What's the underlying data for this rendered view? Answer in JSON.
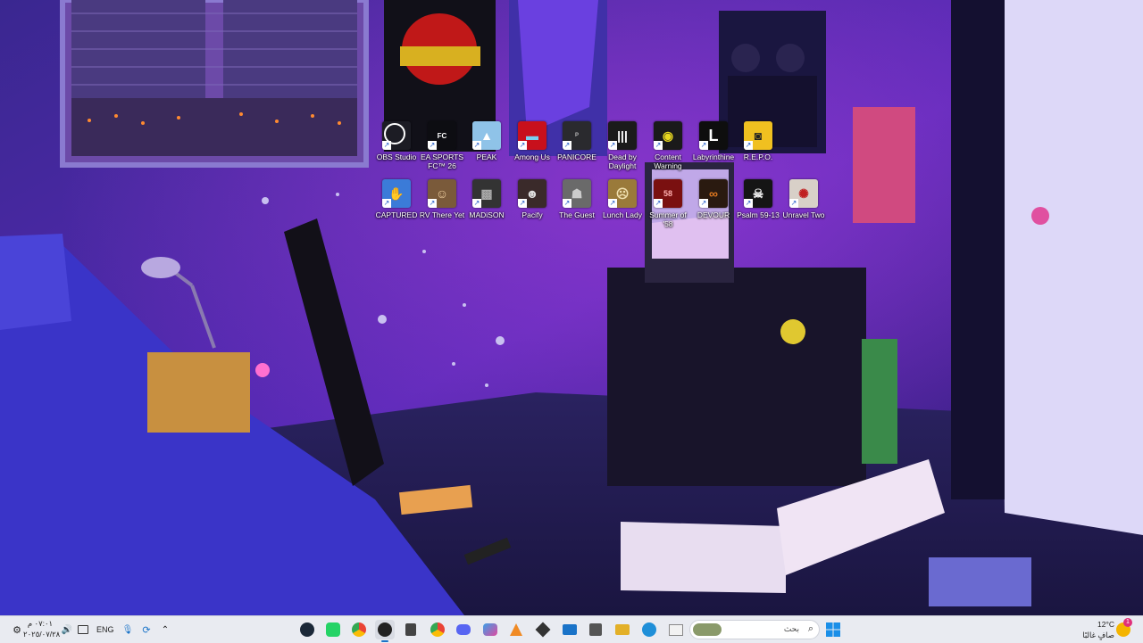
{
  "desktop": {
    "icons_row1": [
      {
        "label": "OBS Studio",
        "icon": "obs-icon",
        "color": "#1c1c24"
      },
      {
        "label": "EA SPORTS FC™ 26",
        "icon": "fc26-icon",
        "color": "#0d0d12"
      },
      {
        "label": "PEAK",
        "icon": "peak-icon",
        "color": "#8fc3e8"
      },
      {
        "label": "Among Us",
        "icon": "among-us-icon",
        "color": "#c8101c"
      },
      {
        "label": "PANICORE",
        "icon": "panicore-icon",
        "color": "#2a2a2e"
      },
      {
        "label": "Dead by Daylight",
        "icon": "dead-by-daylight-icon",
        "color": "#1b1b1b"
      },
      {
        "label": "Content Warning",
        "icon": "content-warning-icon",
        "color": "#1a1a1a"
      },
      {
        "label": "Labyrinthine",
        "icon": "labyrinthine-icon",
        "color": "#0e0e0e"
      },
      {
        "label": "R.E.P.O.",
        "icon": "repo-icon",
        "color": "#f0c020"
      }
    ],
    "icons_row2": [
      {
        "label": "CAPTURED",
        "icon": "captured-icon",
        "color": "#3b7bd8"
      },
      {
        "label": "RV There Yet",
        "icon": "rv-there-yet-icon",
        "color": "#7a5a3a"
      },
      {
        "label": "MADiSON",
        "icon": "madison-icon",
        "color": "#333333"
      },
      {
        "label": "Pacify",
        "icon": "pacify-icon",
        "color": "#3a2a2a"
      },
      {
        "label": "The Guest",
        "icon": "the-guest-icon",
        "color": "#6a6a6a"
      },
      {
        "label": "Lunch Lady",
        "icon": "lunch-lady-icon",
        "color": "#9a7a3a"
      },
      {
        "label": "Summer of '58",
        "icon": "summer-of-58-icon",
        "color": "#7a1010"
      },
      {
        "label": "DEVOUR",
        "icon": "devour-icon",
        "color": "#2a1a10"
      },
      {
        "label": "Psalm 59-13",
        "icon": "psalm-icon",
        "color": "#151515"
      },
      {
        "label": "Unravel Two",
        "icon": "unravel-two-icon",
        "color": "#d8d0c8"
      }
    ]
  },
  "taskbar": {
    "start_icon": "windows-start-icon",
    "search_placeholder": "بحث",
    "apps": [
      {
        "name": "explorer-icon",
        "color": "#f2c230",
        "glyph": "▬"
      },
      {
        "name": "edge-icon",
        "color": "#1f8fd8",
        "glyph": "e"
      },
      {
        "name": "files-app-icon",
        "color": "#e3b028",
        "glyph": "▭"
      },
      {
        "name": "store-icon",
        "color": "#333333",
        "glyph": "⊞"
      },
      {
        "name": "mail-icon",
        "color": "#1a73c8",
        "glyph": "✉"
      },
      {
        "name": "app-dark-icon",
        "color": "#333333",
        "glyph": "◆"
      },
      {
        "name": "vlc-like-icon",
        "color": "#f08a24",
        "glyph": "▲"
      },
      {
        "name": "copilot-icon",
        "color": "#3aa0e8",
        "glyph": "◈"
      },
      {
        "name": "discord-icon",
        "color": "#5865f2",
        "glyph": "☺"
      },
      {
        "name": "chrome-icon",
        "color": "#2fa44f",
        "glyph": "●"
      },
      {
        "name": "epic-icon",
        "color": "#333333",
        "glyph": "⬢"
      },
      {
        "name": "obs-taskbar-icon",
        "color": "#222222",
        "glyph": "◉"
      },
      {
        "name": "chrome-badge-icon",
        "color": "#dd4b39",
        "glyph": "●"
      },
      {
        "name": "whatsapp-icon",
        "color": "#25d366",
        "glyph": "◙"
      },
      {
        "name": "steam-icon",
        "color": "#1b2838",
        "glyph": "⚙"
      }
    ],
    "tray": {
      "chevron_icon": "chevron-up-icon",
      "sync_icon": "sync-icon",
      "mic_icon": "mic-icon",
      "lang": "ENG",
      "display_icon": "display-icon",
      "volume_icon": "volume-icon",
      "time": "٠٧:٠١ م",
      "date": "٢٠٢٥/٠٧/٢٨",
      "settings_icon": "gear-icon"
    },
    "weather": {
      "temp": "12°C",
      "condition": "صافٍ غالبًا",
      "badge": "1"
    }
  }
}
